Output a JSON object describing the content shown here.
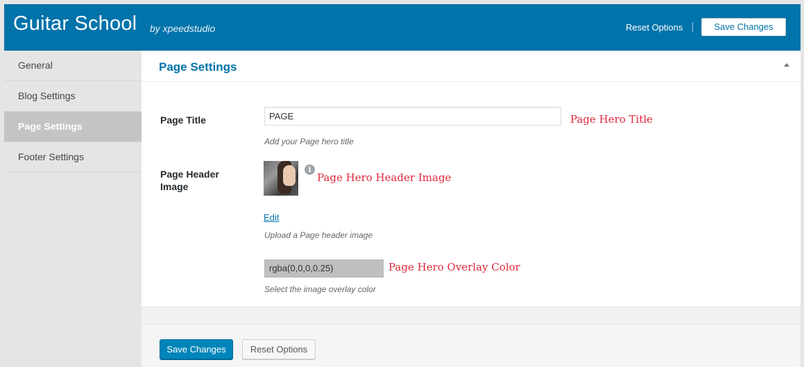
{
  "header": {
    "title": "Guitar School",
    "byline": "by xpeedstudio",
    "reset_label": "Reset Options",
    "save_label": "Save Changes"
  },
  "sidebar": {
    "items": [
      {
        "label": "General",
        "active": false
      },
      {
        "label": "Blog Settings",
        "active": false
      },
      {
        "label": "Page Settings",
        "active": true
      },
      {
        "label": "Footer Settings",
        "active": false
      }
    ]
  },
  "panel": {
    "title": "Page Settings",
    "page_title": {
      "label": "Page Title",
      "value": "PAGE",
      "description": "Add your Page hero title",
      "annotation": "Page Hero Title"
    },
    "header_image": {
      "label_line1": "Page Header",
      "label_line2": "Image",
      "info_glyph": "i",
      "edit_label": "Edit",
      "description": "Upload a Page header image",
      "annotation": "Page Hero Header Image"
    },
    "overlay_color": {
      "value": "rgba(0,0,0,0.25)",
      "description": "Select the image overlay color",
      "annotation": "Page Hero Overlay Color"
    }
  },
  "footer": {
    "save_label": "Save Changes",
    "reset_label": "Reset Options"
  },
  "colors": {
    "header_bg": "#0073aa",
    "accent": "#0073aa",
    "annotation": "#e0283a",
    "primary_button": "#0085ba"
  },
  "icons": [
    "info-icon",
    "collapse-arrow-icon"
  ]
}
